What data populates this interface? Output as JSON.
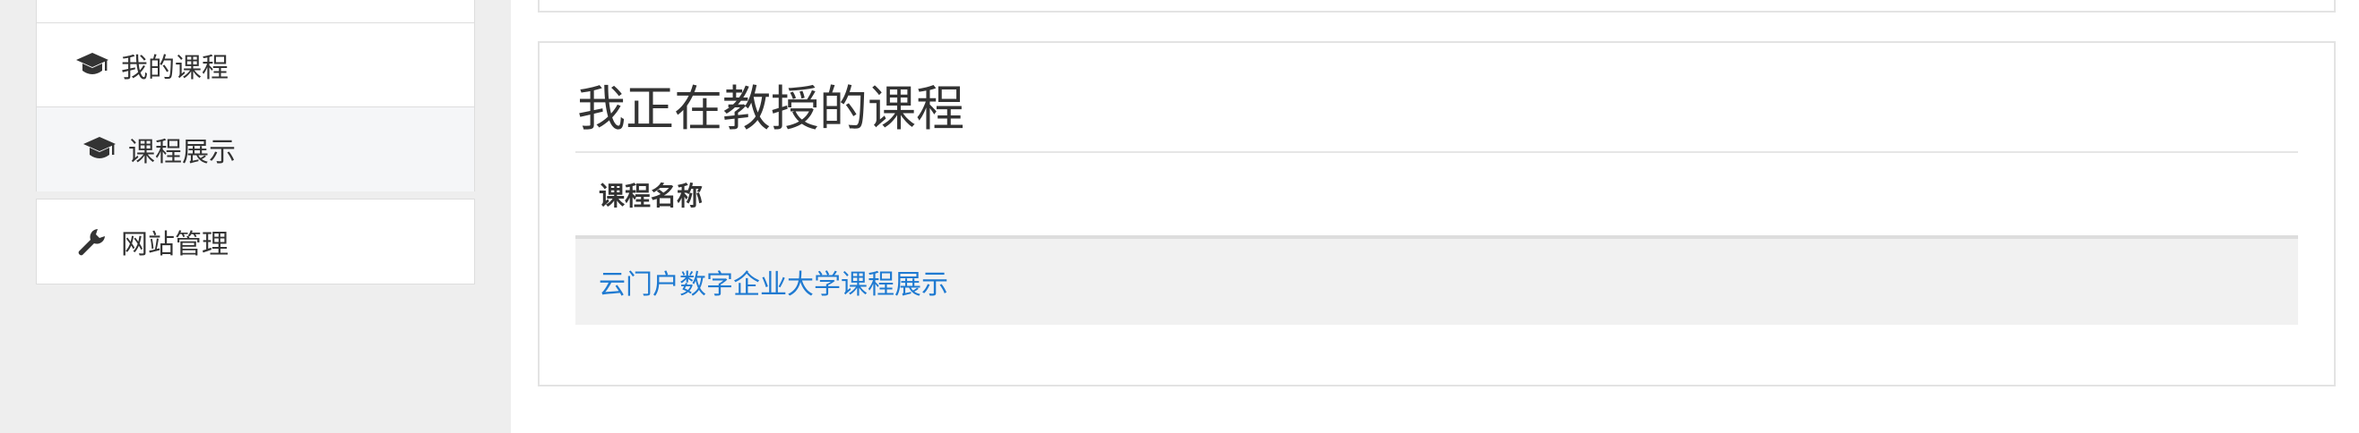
{
  "sidebar": {
    "items": [
      {
        "label": "我的课程",
        "icon": "graduation-cap-icon"
      },
      {
        "label": "课程展示",
        "icon": "graduation-cap-icon",
        "active": true
      },
      {
        "label": "网站管理",
        "icon": "wrench-icon"
      }
    ]
  },
  "panel": {
    "title": "我正在教授的课程",
    "table": {
      "columns": [
        "课程名称"
      ],
      "rows": [
        {
          "name": "云门户数字企业大学课程展示"
        }
      ]
    }
  },
  "colors": {
    "sidebar_bg": "#eeeeee",
    "active_item_bg": "#f5f6f8",
    "link": "#1f7ad1",
    "row_bg": "#f1f1f1",
    "border": "#dddddd"
  }
}
